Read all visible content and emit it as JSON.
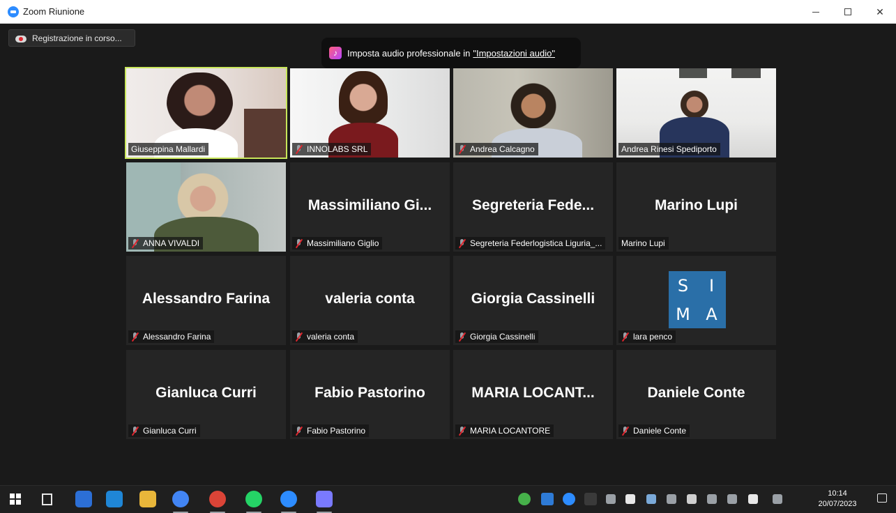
{
  "window": {
    "title": "Zoom Riunione",
    "controls": [
      "minimize",
      "maximize",
      "close"
    ]
  },
  "recording": {
    "label": "Registrazione in corso..."
  },
  "toast": {
    "text": "Imposta audio professionale in",
    "link": "\"Impostazioni audio\""
  },
  "participants": [
    {
      "display": "",
      "label": "Giuseppina Mallardi",
      "muted": false,
      "video": true,
      "active": true
    },
    {
      "display": "",
      "label": "INNOLABS SRL",
      "muted": true,
      "video": true
    },
    {
      "display": "",
      "label": "Andrea Calcagno",
      "muted": true,
      "video": true
    },
    {
      "display": "",
      "label": "Andrea Rinesi Spediporto",
      "muted": false,
      "video": true
    },
    {
      "display": "",
      "label": "ANNA VIVALDI",
      "muted": true,
      "video": true
    },
    {
      "display": "Massimiliano  Gi...",
      "label": "Massimiliano Giglio",
      "muted": true,
      "video": false
    },
    {
      "display": "Segreteria  Fede...",
      "label": "Segreteria Federlogistica Liguria_...",
      "muted": true,
      "video": false
    },
    {
      "display": "Marino Lupi",
      "label": "Marino Lupi",
      "muted": false,
      "video": false
    },
    {
      "display": "Alessandro Farina",
      "label": "Alessandro Farina",
      "muted": true,
      "video": false
    },
    {
      "display": "valeria conta",
      "label": "valeria conta",
      "muted": true,
      "video": false
    },
    {
      "display": "Giorgia Cassinelli",
      "label": "Giorgia Cassinelli",
      "muted": true,
      "video": false
    },
    {
      "display": "",
      "label": "lara penco",
      "muted": true,
      "video": false,
      "logo": [
        "S",
        "I",
        "M",
        "A"
      ]
    },
    {
      "display": "Gianluca Curri",
      "label": "Gianluca Curri",
      "muted": true,
      "video": false
    },
    {
      "display": "Fabio Pastorino",
      "label": "Fabio Pastorino",
      "muted": true,
      "video": false
    },
    {
      "display": "MARIA  LOCANT...",
      "label": "MARIA LOCANTORE",
      "muted": true,
      "video": false
    },
    {
      "display": "Daniele Conte",
      "label": "Daniele Conte",
      "muted": true,
      "video": false
    }
  ],
  "colors": {
    "active_speaker": "#c8e65a",
    "tile_bg": "#252525",
    "meeting_bg": "#1a1a1a",
    "taskbar_bg": "#1f1f1f",
    "sima_blue": "#2a6fa8"
  },
  "taskbar": {
    "apps": [
      "start-icon",
      "task-view-icon",
      "store-icon",
      "edge-icon",
      "file-explorer-icon",
      "chrome-icon",
      "chrome-profile-icon",
      "whatsapp-icon",
      "zoom-icon",
      "paint-icon"
    ],
    "tray": [
      "check-icon",
      "app-icon",
      "zoom-tray-icon",
      "calendar-icon",
      "settings-icon",
      "shield-icon",
      "network-drive-icon",
      "wifi-icon",
      "battery-icon",
      "display-icon",
      "volume-icon",
      "microphone-icon",
      "pen-icon"
    ],
    "time": "10:14",
    "date": "20/07/2023"
  }
}
